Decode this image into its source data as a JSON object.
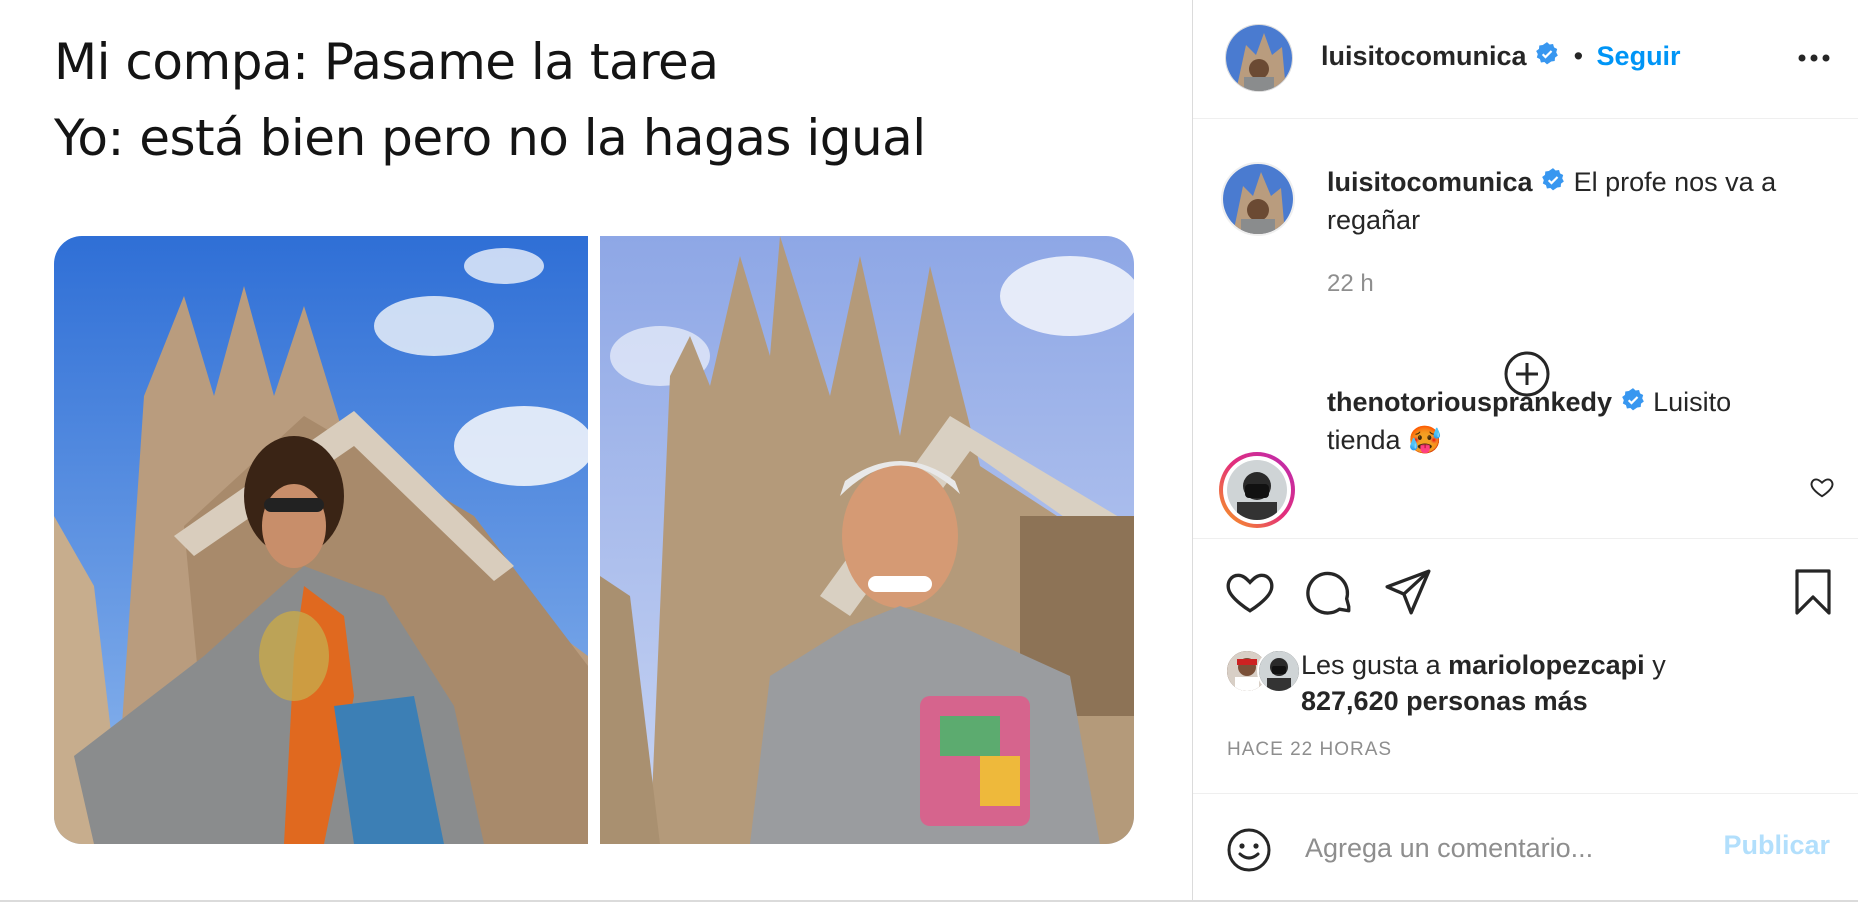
{
  "meme": {
    "line1": "Mi compa: Pasame la tarea",
    "line2": "Yo: está bien pero no la hagas igual"
  },
  "header": {
    "username": "luisitocomunica",
    "separator": "•",
    "follow_label": "Seguir",
    "more_icon": "more-horizontal-icon"
  },
  "caption": {
    "username": "luisitocomunica",
    "text": "El profe nos va a regañar",
    "time": "22 h"
  },
  "load_more_icon": "plus-circle-icon",
  "comment": {
    "username": "thenotoriousprankedy",
    "text": "Luisito tienda",
    "emoji": "🥵"
  },
  "likes": {
    "prefix": "Les gusta a",
    "user": "mariolopezcapi",
    "conj": "y",
    "count_text": "827,620 personas más"
  },
  "posted_ago": "HACE 22 HORAS",
  "comment_box": {
    "placeholder": "Agrega un comentario...",
    "publish_label": "Publicar"
  },
  "colors": {
    "accent": "#0095f6",
    "verified": "#3897f0",
    "publish_disabled": "#b2dffc",
    "muted": "#8e8e8e"
  }
}
